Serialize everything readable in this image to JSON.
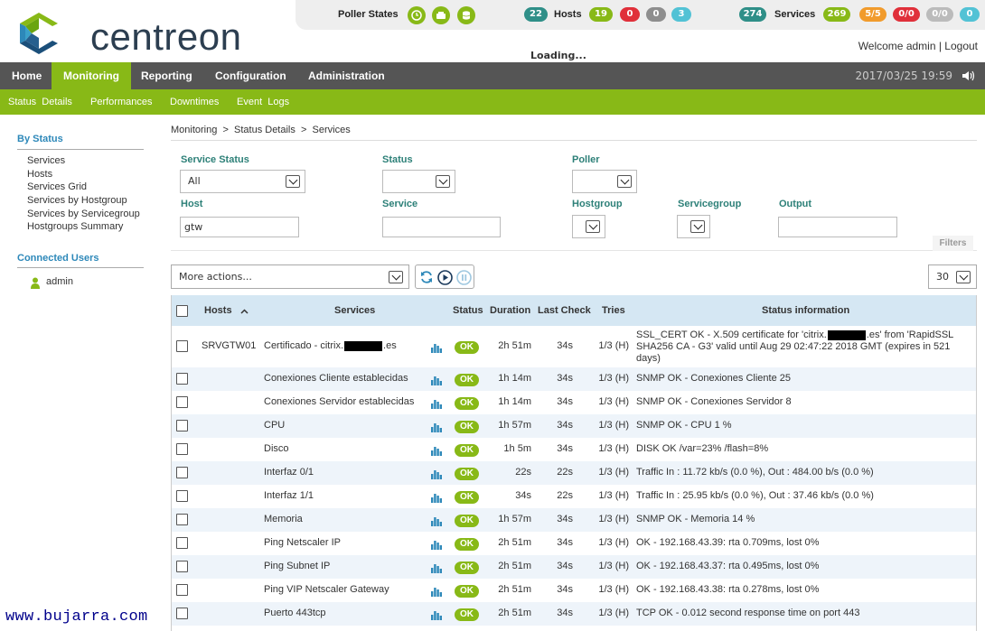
{
  "app": {
    "logo_text": "centreon"
  },
  "statusbar": {
    "poller_label": "Poller States",
    "hosts_total": "22",
    "hosts_label": "Hosts",
    "hosts_up": "19",
    "hosts_down": "0",
    "hosts_unreach": "0",
    "hosts_pending": "3",
    "services_total": "274",
    "services_label": "Services",
    "svc_ok": "269",
    "svc_warning": "5/5",
    "svc_critical": "0/0",
    "svc_unknown": "0/0",
    "svc_pending": "0"
  },
  "loading": "Loading...",
  "user": {
    "welcome": "Welcome admin",
    "sep": " | ",
    "logout": "Logout"
  },
  "mainnav": {
    "home": "Home",
    "monitoring": "Monitoring",
    "reporting": "Reporting",
    "configuration": "Configuration",
    "administration": "Administration"
  },
  "datetime": "2017/03/25 19:59",
  "subnav": {
    "status_details": "Status  Details",
    "performances": "Performances",
    "downtimes": "Downtimes",
    "event_logs": "Event  Logs"
  },
  "sidebar": {
    "by_status": "By Status",
    "items": [
      "Services",
      "Hosts",
      "Services Grid",
      "Services by Hostgroup",
      "Services by Servicegroup",
      "Hostgroups Summary"
    ],
    "connected_users": "Connected Users",
    "users": [
      "admin"
    ]
  },
  "breadcrumb": "Monitoring  >  Status Details  >  Services",
  "filters": {
    "service_status_label": "Service Status",
    "service_status_value": "All",
    "status_label": "Status",
    "status_value": "",
    "poller_label": "Poller",
    "poller_value": "",
    "host_label": "Host",
    "host_value": "gtw",
    "service_label": "Service",
    "service_value": "",
    "hostgroup_label": "Hostgroup",
    "servicegroup_label": "Servicegroup",
    "output_label": "Output",
    "output_value": "",
    "tab_label": "Filters"
  },
  "actions": {
    "more_actions": "More actions...",
    "page_size": "30"
  },
  "table": {
    "headers": {
      "hosts": "Hosts",
      "services": "Services",
      "status": "Status",
      "duration": "Duration",
      "last_check": "Last Check",
      "tries": "Tries",
      "status_info": "Status information"
    },
    "rows": [
      {
        "host": "SRVGTW01",
        "service_pre": "Certificado - citrix.",
        "service_post": ".es",
        "status": "OK",
        "duration": "2h 51m",
        "last_check": "34s",
        "tries": "1/3 (H)",
        "info_l1_pre": "SSL_CERT OK - X.509 certificate for 'citrix.",
        "info_l1_post": ".es' from 'RapidSSL",
        "info_l2": "SHA256 CA - G3' valid until Aug 29 02:47:22 2018 GMT (expires in 521",
        "info_l3": "days)"
      },
      {
        "host": "",
        "service": "Conexiones Cliente establecidas",
        "status": "OK",
        "duration": "1h 14m",
        "last_check": "34s",
        "tries": "1/3 (H)",
        "info": "SNMP OK - Conexiones Cliente 25"
      },
      {
        "host": "",
        "service": "Conexiones Servidor establecidas",
        "status": "OK",
        "duration": "1h 14m",
        "last_check": "34s",
        "tries": "1/3 (H)",
        "info": "SNMP OK - Conexiones Servidor 8"
      },
      {
        "host": "",
        "service": "CPU",
        "status": "OK",
        "duration": "1h 57m",
        "last_check": "34s",
        "tries": "1/3 (H)",
        "info": "SNMP OK - CPU 1 %"
      },
      {
        "host": "",
        "service": "Disco",
        "status": "OK",
        "duration": "1h 5m",
        "last_check": "34s",
        "tries": "1/3 (H)",
        "info": "DISK OK /var=23% /flash=8%"
      },
      {
        "host": "",
        "service": "Interfaz 0/1",
        "status": "OK",
        "duration": "22s",
        "last_check": "22s",
        "tries": "1/3 (H)",
        "info": "Traffic In : 11.72 kb/s (0.0 %), Out : 484.00 b/s (0.0 %)"
      },
      {
        "host": "",
        "service": "Interfaz 1/1",
        "status": "OK",
        "duration": "34s",
        "last_check": "22s",
        "tries": "1/3 (H)",
        "info": "Traffic In : 25.95 kb/s (0.0 %), Out : 37.46 kb/s (0.0 %)"
      },
      {
        "host": "",
        "service": "Memoria",
        "status": "OK",
        "duration": "1h 57m",
        "last_check": "34s",
        "tries": "1/3 (H)",
        "info": "SNMP OK - Memoria 14 %"
      },
      {
        "host": "",
        "service": "Ping Netscaler IP",
        "status": "OK",
        "duration": "2h 51m",
        "last_check": "34s",
        "tries": "1/3 (H)",
        "info": "OK - 192.168.43.39: rta 0.709ms, lost 0%"
      },
      {
        "host": "",
        "service": "Ping Subnet IP",
        "status": "OK",
        "duration": "2h 51m",
        "last_check": "34s",
        "tries": "1/3 (H)",
        "info": "OK - 192.168.43.37: rta 0.495ms, lost 0%"
      },
      {
        "host": "",
        "service": "Ping VIP Netscaler Gateway",
        "status": "OK",
        "duration": "2h 51m",
        "last_check": "34s",
        "tries": "1/3 (H)",
        "info": "OK - 192.168.43.38: rta 0.278ms, lost 0%"
      },
      {
        "host": "",
        "service": "Puerto 443tcp",
        "status": "OK",
        "duration": "2h 51m",
        "last_check": "34s",
        "tries": "1/3 (H)",
        "info": "TCP OK - 0.012 second response time on port 443"
      }
    ]
  },
  "watermark": "www.bujarra.com",
  "colors": {
    "brand_green": "#88b917",
    "nav_dark": "#555555",
    "header_blue": "#d5e7f3",
    "sidebar_blue": "#2d88b9"
  }
}
